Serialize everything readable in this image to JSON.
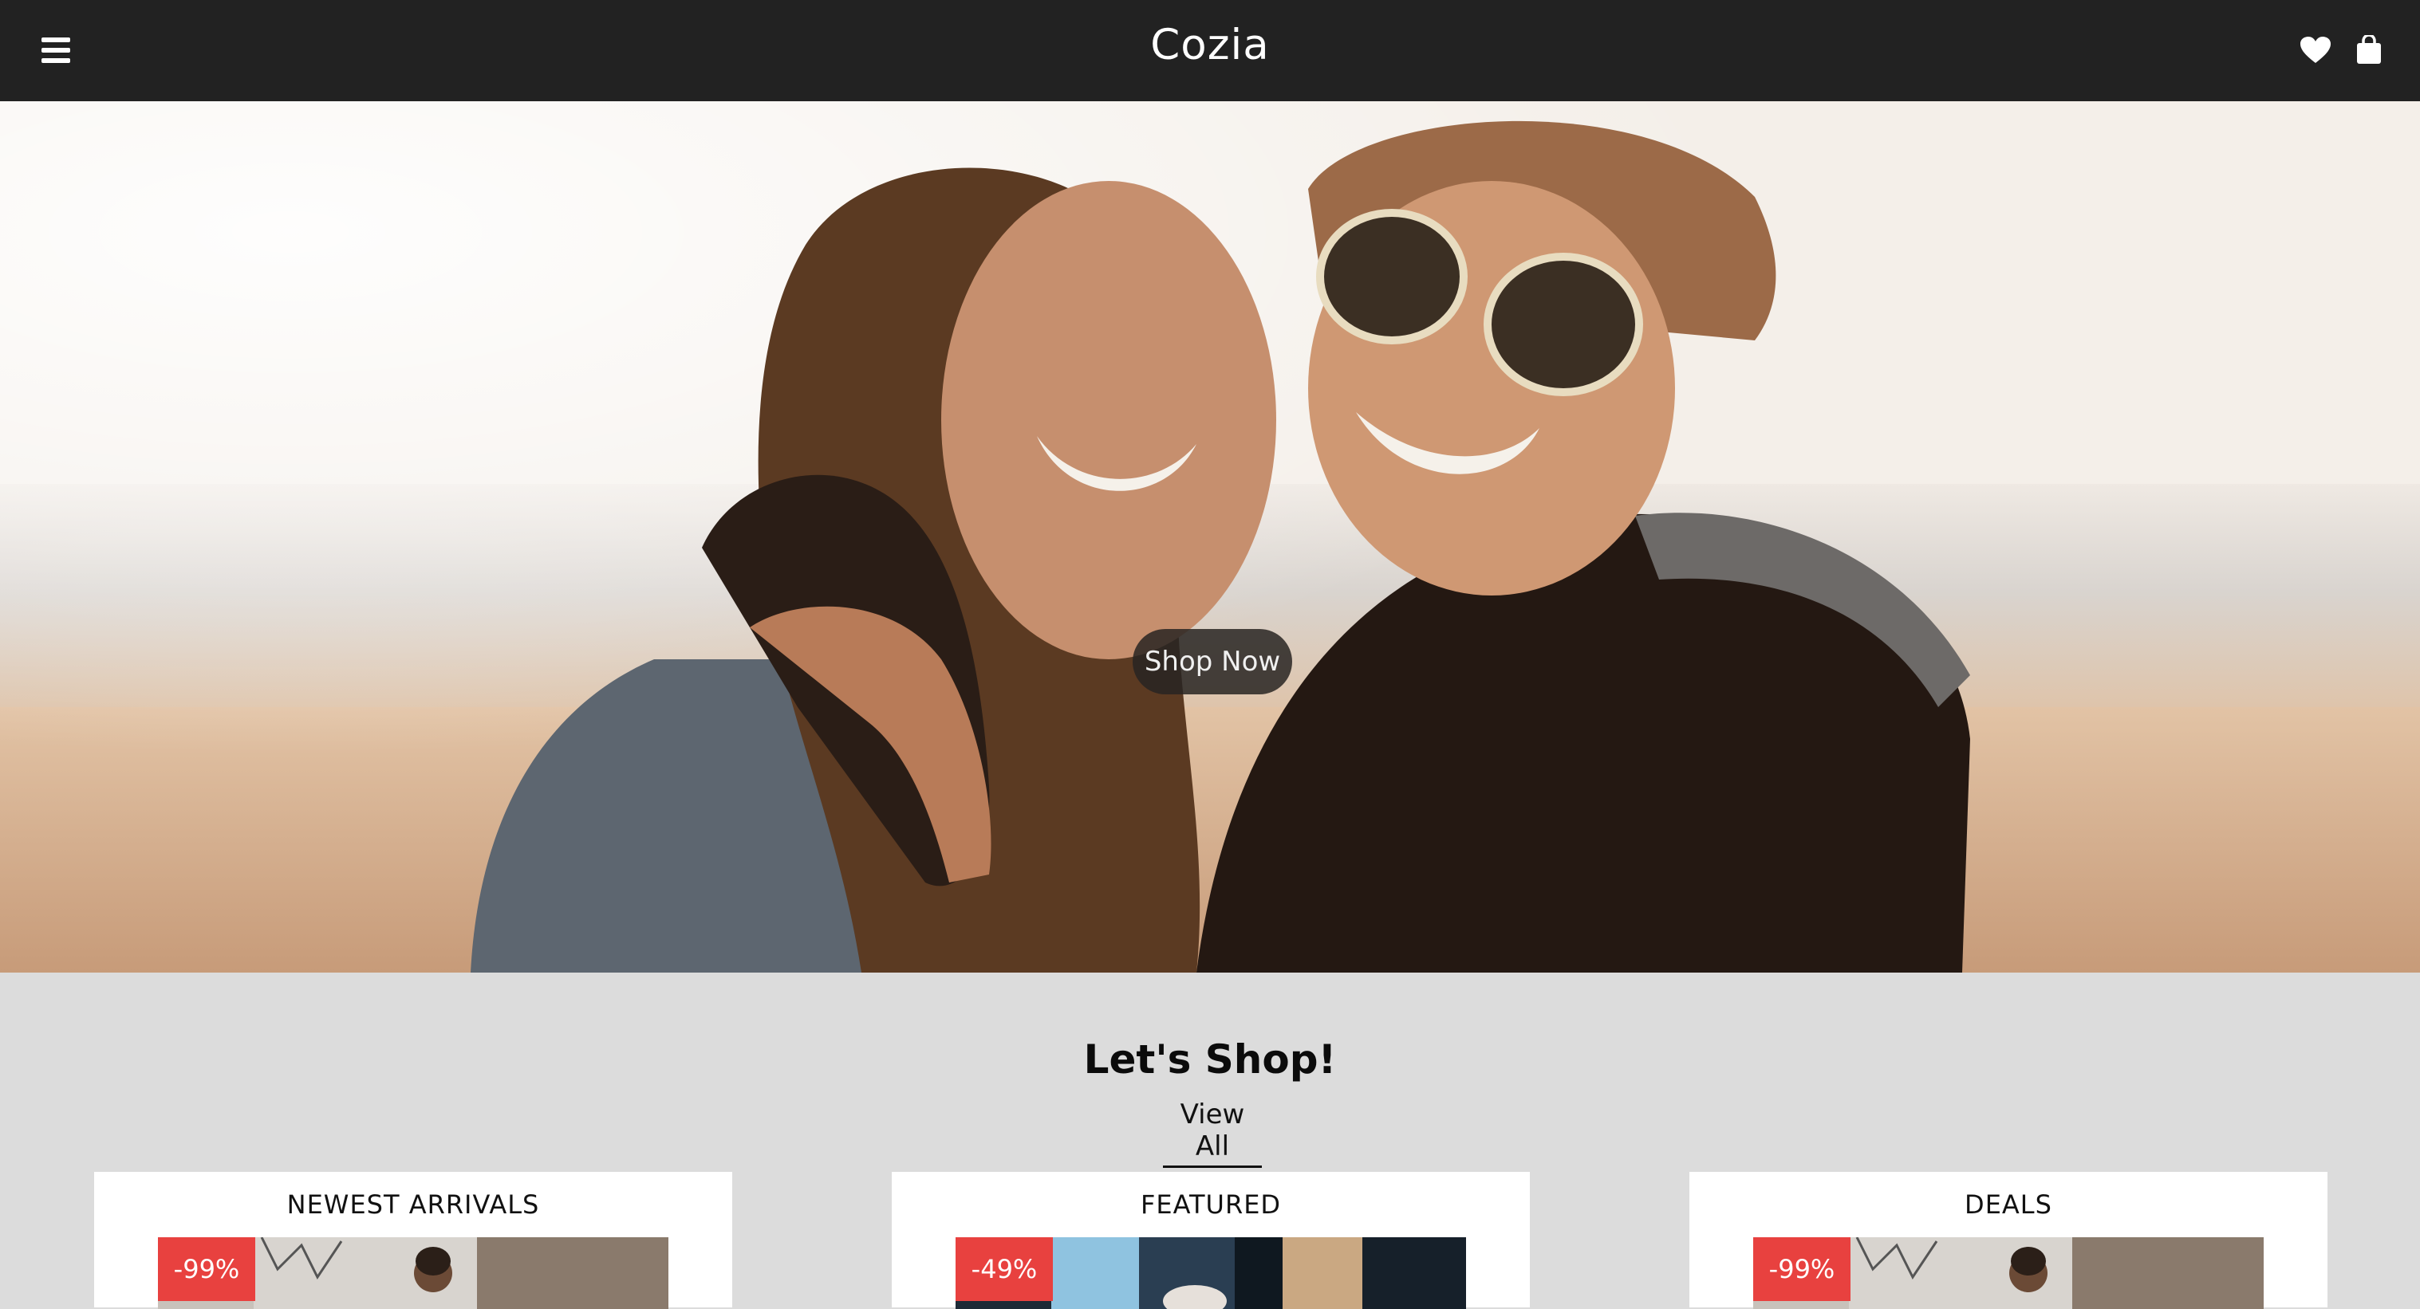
{
  "header": {
    "brand": "Cozia",
    "menu_icon": "hamburger-menu-icon",
    "wishlist_icon": "heart-icon",
    "cart_icon": "shopping-bag-icon",
    "background_color": "#222222"
  },
  "hero": {
    "cta_label": "Shop Now"
  },
  "shop": {
    "title": "Let's Shop!",
    "view_all_label": "View All"
  },
  "cards": [
    {
      "title": "NEWEST ARRIVALS",
      "badge": "-99%"
    },
    {
      "title": "FEATURED",
      "badge": "-49%"
    },
    {
      "title": "DEALS",
      "badge": "-99%"
    }
  ],
  "colors": {
    "page_background": "#dcdcdc",
    "badge": "#e8413f",
    "card": "#ffffff"
  }
}
